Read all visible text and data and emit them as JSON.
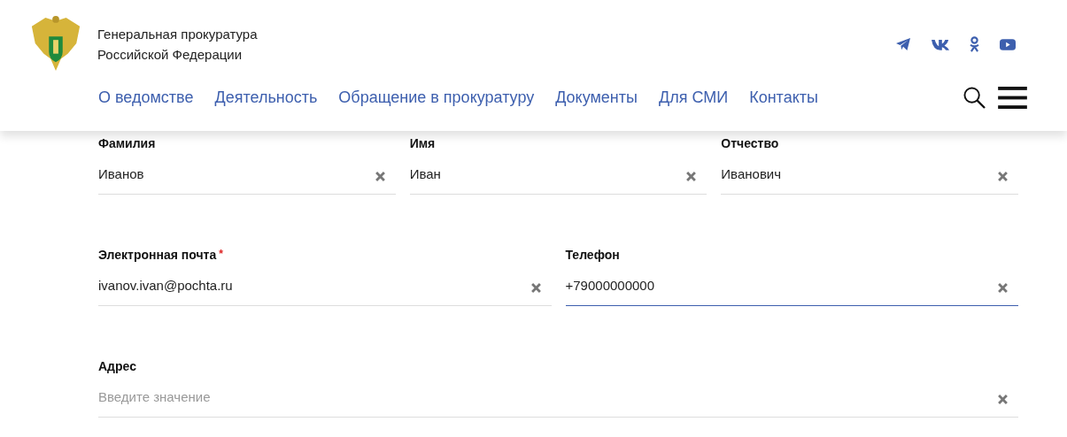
{
  "header": {
    "org_name": [
      "Генеральная прокуратура",
      "Российской Федерации"
    ],
    "nav": [
      "О ведомстве",
      "Деятельность",
      "Обращение в прокуратуру",
      "Документы",
      "Для СМИ",
      "Контакты"
    ]
  },
  "form": {
    "rows": [
      [
        {
          "label": "Фамилия",
          "value": "Иванов",
          "active": false
        },
        {
          "label": "Имя",
          "value": "Иван",
          "active": false
        },
        {
          "label": "Отчество",
          "value": "Иванович",
          "active": false
        }
      ],
      [
        {
          "label": "Электронная почта",
          "required_mark": "*",
          "value": "ivanov.ivan@pochta.ru",
          "active": false
        },
        {
          "label": "Телефон",
          "value": "+79000000000",
          "active": true
        }
      ],
      [
        {
          "label": "Адрес",
          "placeholder": "Введите значение",
          "active": false
        }
      ]
    ]
  }
}
